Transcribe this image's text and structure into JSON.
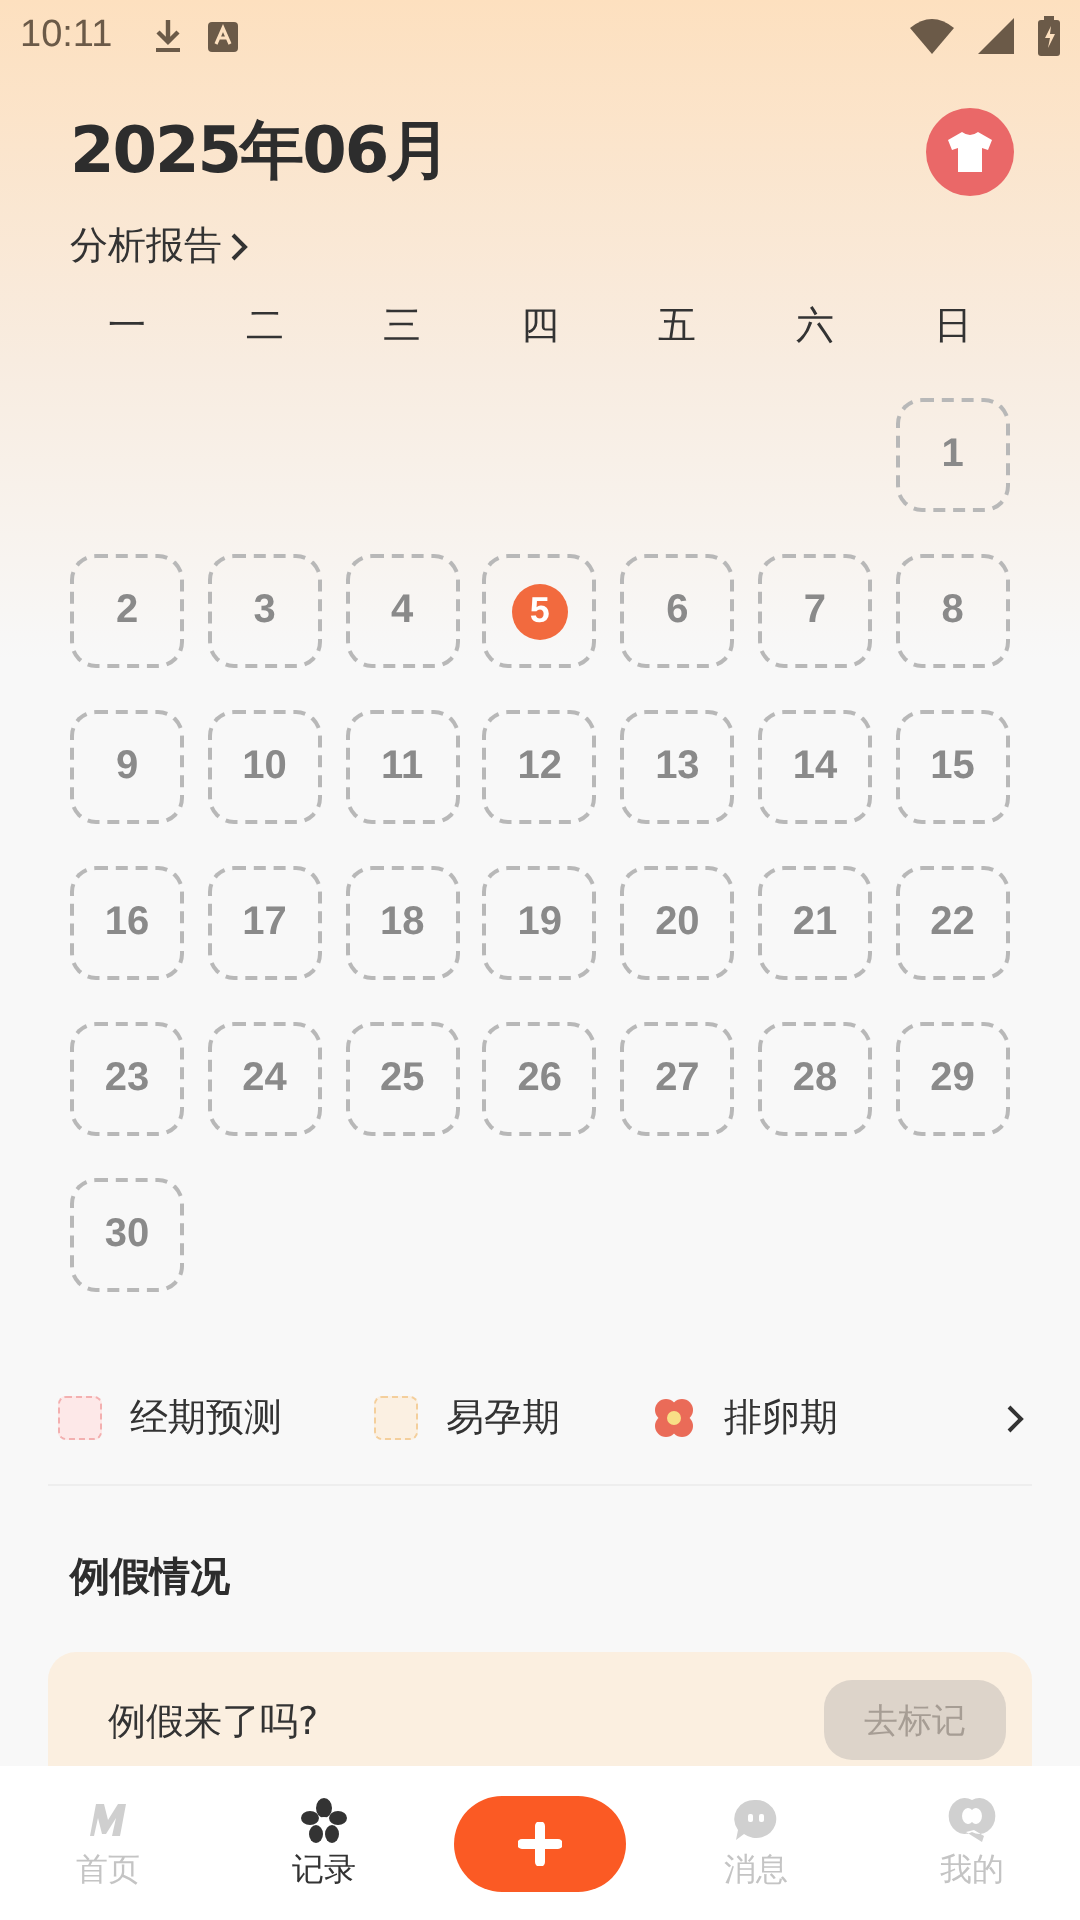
{
  "status_bar": {
    "time": "10:11"
  },
  "header": {
    "title": "2025年06月",
    "report_link": "分析报告"
  },
  "calendar": {
    "weekdays": [
      "一",
      "二",
      "三",
      "四",
      "五",
      "六",
      "日"
    ],
    "weeks": [
      [
        {
          "kind": "empty"
        },
        {
          "kind": "empty"
        },
        {
          "kind": "empty"
        },
        {
          "kind": "empty"
        },
        {
          "kind": "empty"
        },
        {
          "kind": "empty"
        },
        {
          "kind": "day",
          "day": "1",
          "today": false
        }
      ],
      [
        {
          "kind": "day",
          "day": "2",
          "today": false
        },
        {
          "kind": "day",
          "day": "3",
          "today": false
        },
        {
          "kind": "day",
          "day": "4",
          "today": false
        },
        {
          "kind": "day",
          "day": "5",
          "today": true
        },
        {
          "kind": "day",
          "day": "6",
          "today": false
        },
        {
          "kind": "day",
          "day": "7",
          "today": false
        },
        {
          "kind": "day",
          "day": "8",
          "today": false
        }
      ],
      [
        {
          "kind": "day",
          "day": "9",
          "today": false
        },
        {
          "kind": "day",
          "day": "10",
          "today": false
        },
        {
          "kind": "day",
          "day": "11",
          "today": false
        },
        {
          "kind": "day",
          "day": "12",
          "today": false
        },
        {
          "kind": "day",
          "day": "13",
          "today": false
        },
        {
          "kind": "day",
          "day": "14",
          "today": false
        },
        {
          "kind": "day",
          "day": "15",
          "today": false
        }
      ],
      [
        {
          "kind": "day",
          "day": "16",
          "today": false
        },
        {
          "kind": "day",
          "day": "17",
          "today": false
        },
        {
          "kind": "day",
          "day": "18",
          "today": false
        },
        {
          "kind": "day",
          "day": "19",
          "today": false
        },
        {
          "kind": "day",
          "day": "20",
          "today": false
        },
        {
          "kind": "day",
          "day": "21",
          "today": false
        },
        {
          "kind": "day",
          "day": "22",
          "today": false
        }
      ],
      [
        {
          "kind": "day",
          "day": "23",
          "today": false
        },
        {
          "kind": "day",
          "day": "24",
          "today": false
        },
        {
          "kind": "day",
          "day": "25",
          "today": false
        },
        {
          "kind": "day",
          "day": "26",
          "today": false
        },
        {
          "kind": "day",
          "day": "27",
          "today": false
        },
        {
          "kind": "day",
          "day": "28",
          "today": false
        },
        {
          "kind": "day",
          "day": "29",
          "today": false
        }
      ],
      [
        {
          "kind": "day",
          "day": "30",
          "today": false
        },
        {
          "kind": "empty"
        },
        {
          "kind": "empty"
        },
        {
          "kind": "empty"
        },
        {
          "kind": "empty"
        },
        {
          "kind": "empty"
        },
        {
          "kind": "empty"
        }
      ]
    ]
  },
  "legend": [
    {
      "kind": "period",
      "label": "经期预测"
    },
    {
      "kind": "fertile",
      "label": "易孕期"
    },
    {
      "kind": "ovulation",
      "label": "排卵期"
    }
  ],
  "section": {
    "title": "例假情况",
    "card": {
      "question": "例假来了吗?",
      "button": "去标记"
    }
  },
  "nav": [
    {
      "kind": "tab",
      "label": "首页",
      "selected": false
    },
    {
      "kind": "tab",
      "label": "记录",
      "selected": true
    },
    {
      "kind": "add"
    },
    {
      "kind": "tab",
      "label": "消息",
      "selected": false
    },
    {
      "kind": "tab",
      "label": "我的",
      "selected": false
    }
  ]
}
